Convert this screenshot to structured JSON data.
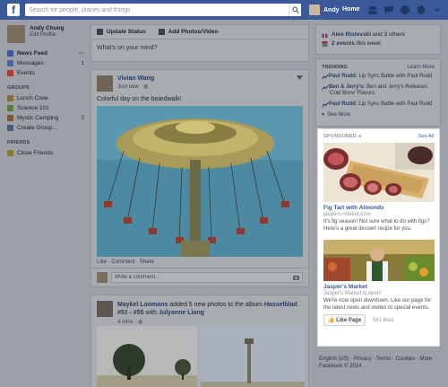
{
  "topbar": {
    "logo": "f",
    "search_placeholder": "Search for people, places and things",
    "user_name": "Andy",
    "home_label": "Home",
    "icons": [
      "friends-icon",
      "messages-icon",
      "notifications-icon",
      "privacy-icon",
      "settings-icon"
    ]
  },
  "left": {
    "profile": {
      "name": "Andy Chung",
      "edit": "Edit Profile"
    },
    "items": [
      {
        "label": "News Feed",
        "count": "",
        "bold": true,
        "color": "#3b5998"
      },
      {
        "label": "Messages",
        "count": "1",
        "bold": false,
        "color": "#4b67a1"
      },
      {
        "label": "Events",
        "count": "",
        "bold": false,
        "color": "#c0392b"
      }
    ],
    "groups_title": "GROUPS",
    "groups": [
      {
        "label": "Lunch Crew",
        "count": ""
      },
      {
        "label": "Science 101",
        "count": ""
      },
      {
        "label": "Mystic Camping",
        "count": "2"
      },
      {
        "label": "Create Group...",
        "count": ""
      }
    ],
    "friends_title": "FRIENDS",
    "friends": [
      {
        "label": "Close Friends"
      }
    ]
  },
  "composer": {
    "update_status": "Update Status",
    "add_photo": "Add Photos/Video",
    "prompt": "What's on your mind?"
  },
  "post1": {
    "author": "Vivian Wang",
    "time": "Just now",
    "text": "Colorful day on the boardwalk!",
    "actions": "Like · Comment · Share",
    "comment_placeholder": "Write a comment..."
  },
  "post2": {
    "author": "Maykel Loomans",
    "action_text": " added 5 new photos to the album",
    "album": "Hasselblad #51 - #55",
    "with_text": " with ",
    "with_name": "Julyanne Liang",
    "time": "4 mins"
  },
  "right": {
    "events": [
      {
        "name": "Alex Ristevski",
        "rest": " and 3 others"
      },
      {
        "name": "2 events",
        "rest": " this week"
      }
    ],
    "trending_title": "TRENDING",
    "learn_more": "Learn More",
    "trends": [
      {
        "name": "Paul Rudd:",
        "text": " Lip Sync Battle with Paul Rudd"
      },
      {
        "name": "Ben & Jerry's:",
        "text": " Ben and Jerry's Releases 'Cold Brew' Flavors"
      },
      {
        "name": "Paul Rudd:",
        "text": " Lip Sync Battle with Paul Rudd"
      }
    ],
    "see_more": "See More"
  },
  "sponsored": {
    "label": "SPONSORED",
    "see_all": "See All",
    "ads": [
      {
        "title": "Fig Tart with Almonds",
        "site": "jaspers-market.com",
        "desc": "It's fig season! Not sure what to do with figs? Here's a great dessert recipe for you."
      },
      {
        "title": "Jasper's Market",
        "site": "Jasper's Market is open!",
        "desc": "We're now open downtown. Like our page for the latest news and invites to special events.",
        "like_button": "Like Page",
        "likes": "541 likes"
      }
    ]
  },
  "footer": {
    "line1": "English (US) · Privacy · Terms · Cookies · More",
    "line2": "Facebook © 2014"
  },
  "colors": {
    "brand": "#3b5998",
    "link": "#365899",
    "highlight_bg": "#ffffff"
  }
}
